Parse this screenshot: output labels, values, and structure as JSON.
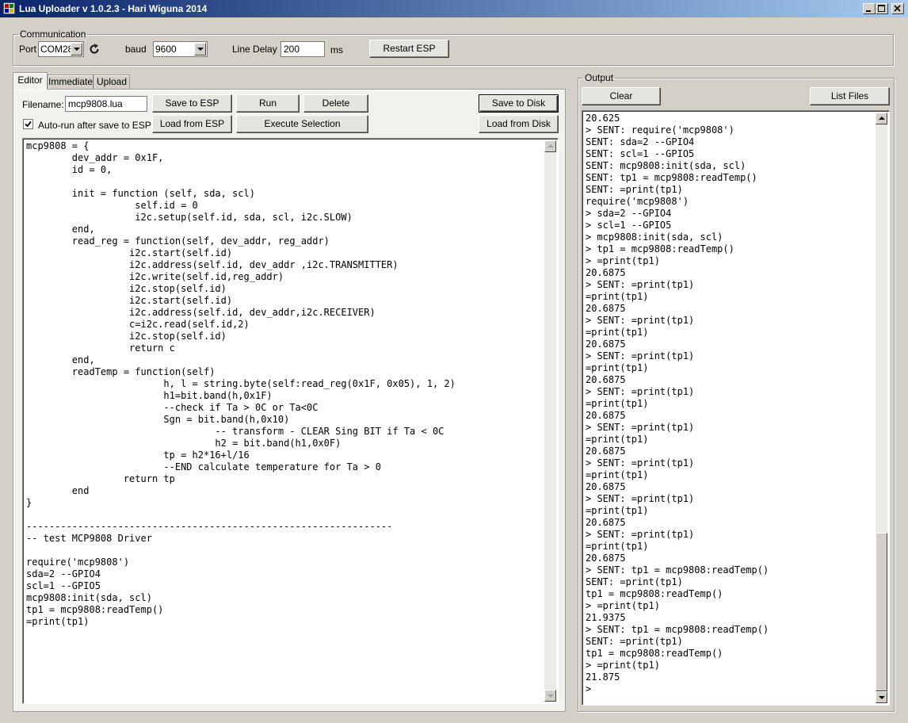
{
  "window": {
    "title": "Lua Uploader v 1.0.2.3 - Hari Wiguna 2014",
    "caption_buttons": [
      "minimize-icon",
      "maximize-icon",
      "close-icon"
    ]
  },
  "communication": {
    "legend": "Communication",
    "port_label": "Port",
    "port_value": "COM28",
    "refresh_icon": "refresh-icon",
    "baud_label": "baud",
    "baud_value": "9600",
    "line_delay_label": "Line Delay",
    "line_delay_value": "200",
    "line_delay_unit": "ms",
    "restart_button": "Restart ESP"
  },
  "tabs": [
    {
      "label": "Editor",
      "active": true
    },
    {
      "label": "Immediate",
      "active": false
    },
    {
      "label": "Upload",
      "active": false
    }
  ],
  "editor": {
    "filename_label": "Filename:",
    "filename_value": "mcp9808.lua",
    "save_to_esp": "Save to ESP",
    "run": "Run",
    "delete": "Delete",
    "save_to_disk": "Save to Disk",
    "autorun_label": "Auto-run after save to ESP",
    "autorun_checked": true,
    "load_from_esp": "Load from ESP",
    "execute_selection": "Execute Selection",
    "load_from_disk": "Load from Disk",
    "code": "mcp9808 = {\n        dev_addr = 0x1F,\n        id = 0,\n\n        init = function (self, sda, scl)\n                   self.id = 0\n                   i2c.setup(self.id, sda, scl, i2c.SLOW)\n        end,\n        read_reg = function(self, dev_addr, reg_addr)\n                  i2c.start(self.id)\n                  i2c.address(self.id, dev_addr ,i2c.TRANSMITTER)\n                  i2c.write(self.id,reg_addr)\n                  i2c.stop(self.id)\n                  i2c.start(self.id)\n                  i2c.address(self.id, dev_addr,i2c.RECEIVER)\n                  c=i2c.read(self.id,2)\n                  i2c.stop(self.id)\n                  return c\n        end,\n        readTemp = function(self)\n                        h, l = string.byte(self:read_reg(0x1F, 0x05), 1, 2)\n                        h1=bit.band(h,0x1F)\n                        --check if Ta > 0C or Ta<0C\n                        Sgn = bit.band(h,0x10)\n                                 -- transform - CLEAR Sing BIT if Ta < 0C\n                                 h2 = bit.band(h1,0x0F)\n                        tp = h2*16+l/16\n                        --END calculate temperature for Ta > 0\n                 return tp\n        end\n}\n\n----------------------------------------------------------------\n-- test MCP9808 Driver\n\nrequire('mcp9808')\nsda=2 --GPIO4\nscl=1 --GPIO5\nmcp9808:init(sda, scl)\ntp1 = mcp9808:readTemp()\n=print(tp1)"
  },
  "output": {
    "legend": "Output",
    "clear_button": "Clear",
    "list_files_button": "List Files",
    "text": "20.625\n> SENT: require('mcp9808')\nSENT: sda=2 --GPIO4\nSENT: scl=1 --GPIO5\nSENT: mcp9808:init(sda, scl)\nSENT: tp1 = mcp9808:readTemp()\nSENT: =print(tp1)\nrequire('mcp9808')\n> sda=2 --GPIO4\n> scl=1 --GPIO5\n> mcp9808:init(sda, scl)\n> tp1 = mcp9808:readTemp()\n> =print(tp1)\n20.6875\n> SENT: =print(tp1)\n=print(tp1)\n20.6875\n> SENT: =print(tp1)\n=print(tp1)\n20.6875\n> SENT: =print(tp1)\n=print(tp1)\n20.6875\n> SENT: =print(tp1)\n=print(tp1)\n20.6875\n> SENT: =print(tp1)\n=print(tp1)\n20.6875\n> SENT: =print(tp1)\n=print(tp1)\n20.6875\n> SENT: =print(tp1)\n=print(tp1)\n20.6875\n> SENT: =print(tp1)\n=print(tp1)\n20.6875\n> SENT: tp1 = mcp9808:readTemp()\nSENT: =print(tp1)\ntp1 = mcp9808:readTemp()\n> =print(tp1)\n21.9375\n> SENT: tp1 = mcp9808:readTemp()\nSENT: =print(tp1)\ntp1 = mcp9808:readTemp()\n> =print(tp1)\n21.875\n>"
  }
}
